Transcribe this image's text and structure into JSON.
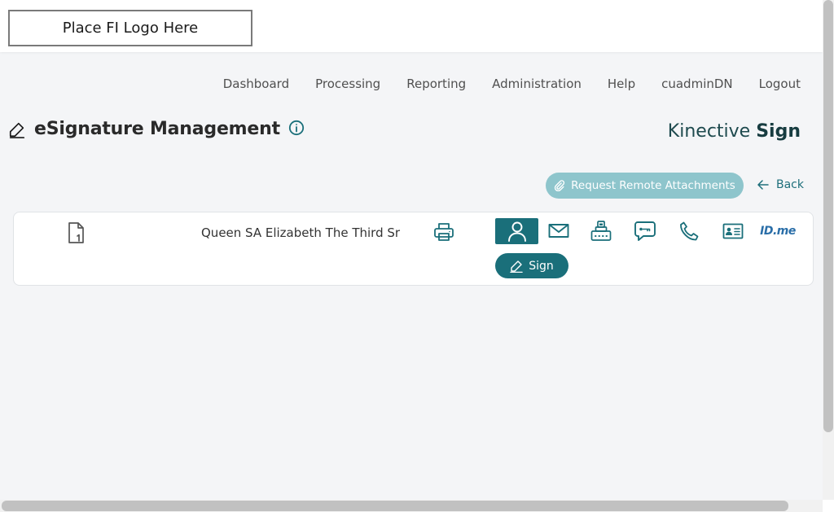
{
  "header": {
    "logo_text": "Place FI Logo Here"
  },
  "nav": {
    "items": [
      {
        "label": "Dashboard"
      },
      {
        "label": "Processing"
      },
      {
        "label": "Reporting"
      },
      {
        "label": "Administration"
      },
      {
        "label": "Help"
      },
      {
        "label": "cuadminDN"
      },
      {
        "label": "Logout"
      }
    ]
  },
  "page": {
    "title": "eSignature Management",
    "brand_prefix": "Kinective",
    "brand_suffix": "Sign"
  },
  "actions": {
    "request_remote_attachments": "Request Remote Attachments",
    "back": "Back"
  },
  "signer": {
    "name": "Queen SA Elizabeth The Third Sr",
    "sign_label": "Sign",
    "idme_prefix": "ID.",
    "idme_suffix": "me"
  },
  "colors": {
    "accent": "#1a6f7a",
    "accent_light": "#8ec5cc",
    "brand_text": "#1e4a4e",
    "idme_blue": "#2a6ea8"
  },
  "icons": [
    "pen-icon",
    "info-icon",
    "paperclip-icon",
    "arrow-left-icon",
    "document-icon",
    "printer-icon",
    "person-icon",
    "mail-icon",
    "token-icon",
    "chat-icon",
    "phone-icon",
    "id-card-icon"
  ]
}
